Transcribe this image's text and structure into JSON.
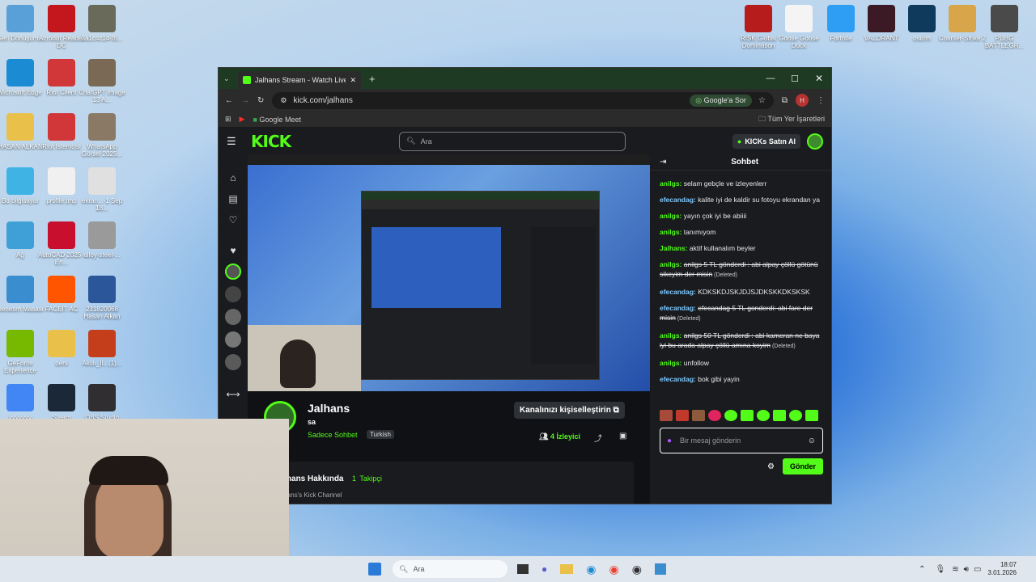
{
  "desktop_left": [
    {
      "label": "Geri Dönüşüm...",
      "icon": "recycle-bin-icon",
      "color": "#5aa0d8",
      "x": 0
    },
    {
      "label": "Acrobat Reader DC",
      "icon": "acrobat-icon",
      "color": "#c4171d",
      "x": 1
    },
    {
      "label": "3a1c4c14-f8...",
      "icon": "file-thumbnail-icon",
      "color": "#6a6a5a",
      "x": 2
    },
    {
      "label": "Microsoft Edge",
      "icon": "edge-icon",
      "color": "#1b8bd4",
      "x": 0
    },
    {
      "label": "Riot Client",
      "icon": "riot-icon",
      "color": "#d13639",
      "x": 1
    },
    {
      "label": "ChatGPT Image 13 A...",
      "icon": "image-file-icon",
      "color": "#7a6a55",
      "x": 2
    },
    {
      "label": "HASAN ALKAN",
      "icon": "folder-icon",
      "color": "#e9c04a",
      "x": 0
    },
    {
      "label": "Riot İstemcisi",
      "icon": "riot-icon",
      "color": "#d13639",
      "x": 1
    },
    {
      "label": "WhatsApp Görsel 2025...",
      "icon": "image-file-icon",
      "color": "#8a7a65",
      "x": 2
    },
    {
      "label": "Bu bilgisayar",
      "icon": "computer-icon",
      "color": "#3fb4e4",
      "x": 0
    },
    {
      "label": "profile.tmp",
      "icon": "file-icon",
      "color": "#f0f0f0",
      "x": 1
    },
    {
      "label": "ekran...-1 Sep 18...",
      "icon": "image-file-icon",
      "color": "#e0e0e0",
      "x": 2
    },
    {
      "label": "Ağ",
      "icon": "network-icon",
      "color": "#3fa0d8",
      "x": 0
    },
    {
      "label": "AutoCAD 2025 - En...",
      "icon": "autocad-icon",
      "color": "#c8102e",
      "x": 1
    },
    {
      "label": "alloy-steel-...",
      "icon": "file-icon",
      "color": "#9a9a9a",
      "x": 2
    },
    {
      "label": "Denetim Masası",
      "icon": "control-panel-icon",
      "color": "#3a8ed0",
      "x": 0
    },
    {
      "label": "FACEIT AC",
      "icon": "faceit-icon",
      "color": "#ff5500",
      "x": 1
    },
    {
      "label": "231820068 Hasan Alkan",
      "icon": "word-icon",
      "color": "#2b579a",
      "x": 2
    },
    {
      "label": "GeForce Experience",
      "icon": "geforce-icon",
      "color": "#76b900",
      "x": 0
    },
    {
      "label": "ders",
      "icon": "folder-icon",
      "color": "#e9c04a",
      "x": 1
    },
    {
      "label": "Akıllı_İl...(1)...",
      "icon": "powerpoint-icon",
      "color": "#c43e1c",
      "x": 2
    },
    {
      "label": "yyyyyyy",
      "icon": "chrome-icon",
      "color": "#4285f4",
      "x": 0
    },
    {
      "label": "Steam",
      "icon": "steam-icon",
      "color": "#1b2838",
      "x": 1
    },
    {
      "label": "OBS Studio",
      "icon": "obs-icon",
      "color": "#302e31",
      "x": 2
    }
  ],
  "desktop_right": [
    {
      "label": "RISK Global Domination",
      "icon": "risk-icon",
      "color": "#b71c1c"
    },
    {
      "label": "Goose Goose Duck",
      "icon": "goose-icon",
      "color": "#f4f4f4"
    },
    {
      "label": "Fortnite",
      "icon": "fortnite-icon",
      "color": "#2e9ef5"
    },
    {
      "label": "VALORANT",
      "icon": "valorant-icon",
      "color": "#3b1a26"
    },
    {
      "label": "osu!m",
      "icon": "osu-icon",
      "color": "#0f3a5c"
    },
    {
      "label": "Counter-Strike 2",
      "icon": "cs2-icon",
      "color": "#d9a54a"
    },
    {
      "label": "PUBG BATTLEGR...",
      "icon": "pubg-icon",
      "color": "#4a4a4a"
    }
  ],
  "browser": {
    "tab_title": "Jalhans Stream - Watch Live on",
    "url": "kick.com/jalhans",
    "google_ask": "Google'a Sor",
    "bookmark_meet": "Google Meet",
    "all_bookmarks": "Tüm Yer İşaretleri",
    "profile_initial": "H"
  },
  "kick": {
    "logo": "KICK",
    "search_placeholder": "Ara",
    "buy_kicks": "KICKs Satın Al",
    "channel_name": "Jalhans",
    "stream_title": "sa",
    "category": "Sadece Sohbet",
    "language_tag": "Turkish",
    "customize_button": "Kanalınızı kişiselleştirin",
    "viewers_count": "4",
    "viewers_label": "İzleyici",
    "about_title": "Jalhans Hakkında",
    "followers_count": "1",
    "followers_label": "Takipçi",
    "about_text": "Jalhans's Kick Channel"
  },
  "chat": {
    "title": "Sohbet",
    "input_placeholder": "Bir mesaj gönderin",
    "send_button": "Gönder",
    "messages": [
      {
        "user": "anilgs",
        "text": "selam gebçle ve izleyenlerr",
        "deleted": false
      },
      {
        "user": "efecandag",
        "text": "kalite iyi de kaldir su fotoyu ekrandan ya",
        "deleted": false
      },
      {
        "user": "anilgs",
        "text": "yayın çok iyi be abiiii",
        "deleted": false
      },
      {
        "user": "anilgs",
        "text": "tanımıyom",
        "deleted": false
      },
      {
        "user": "Jalhans",
        "text": "aktif kullanalım beyler",
        "deleted": false
      },
      {
        "user": "anilgs",
        "text": "anilgs 5 TL gönderdi : abi alpay çöllü götünü sikeyim der misin",
        "deleted": true
      },
      {
        "user": "efecandag",
        "text": "KDKSKDJSKJDJSJDKSKKDKSKSK",
        "deleted": false
      },
      {
        "user": "efecandag",
        "text": "efecandag 5 TL gonderdi: abi fare der misin",
        "deleted": true
      },
      {
        "user": "anilgs",
        "text": "anilgs 50 TL gönderdi : abi kameran ne baya iyi bu arada alpay çöllü amına koyim",
        "deleted": true
      },
      {
        "user": "anilgs",
        "text": "unfollow",
        "deleted": false
      },
      {
        "user": "efecandag",
        "text": "bok gibi yayin",
        "deleted": false
      }
    ],
    "deleted_tag": "(Deleted)"
  },
  "taskbar": {
    "search_placeholder": "Ara",
    "time": "18:07",
    "date": "3.01.2026"
  }
}
